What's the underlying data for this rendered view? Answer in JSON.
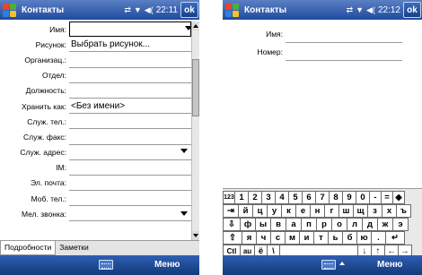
{
  "left_screen": {
    "title": "Контакты",
    "clock": "22:11",
    "ok_label": "ok",
    "fields": [
      {
        "label": "Имя:",
        "value": ""
      },
      {
        "label": "Рисунок:",
        "value": "Выбрать рисунок..."
      },
      {
        "label": "Организац.:",
        "value": ""
      },
      {
        "label": "Отдел:",
        "value": ""
      },
      {
        "label": "Должность:",
        "value": ""
      },
      {
        "label": "Хранить как:",
        "value": "<Без имени>"
      },
      {
        "label": "Служ. тел.:",
        "value": ""
      },
      {
        "label": "Служ. факс:",
        "value": ""
      },
      {
        "label": "Служ. адрес:",
        "value": ""
      },
      {
        "label": "IM:",
        "value": ""
      },
      {
        "label": "Эл. почта:",
        "value": ""
      },
      {
        "label": "Моб. тел.:",
        "value": ""
      },
      {
        "label": "Мел. звонка:",
        "value": ""
      }
    ],
    "tabs": [
      "Подробности",
      "Заметки"
    ],
    "menu_label": "Меню"
  },
  "right_screen": {
    "title": "Контакты",
    "clock": "22:12",
    "ok_label": "ok",
    "fields": [
      {
        "label": "Имя:",
        "value": ""
      },
      {
        "label": "Номер:",
        "value": ""
      }
    ],
    "keyboard": {
      "rows": [
        [
          "123",
          "1",
          "2",
          "3",
          "4",
          "5",
          "6",
          "7",
          "8",
          "9",
          "0",
          "-",
          "=",
          "◆"
        ],
        [
          "⇥",
          "й",
          "ц",
          "у",
          "к",
          "е",
          "н",
          "г",
          "ш",
          "щ",
          "з",
          "х",
          "ъ"
        ],
        [
          "⇩",
          "ф",
          "ы",
          "в",
          "а",
          "п",
          "р",
          "о",
          "л",
          "д",
          "ж",
          "э"
        ],
        [
          "⇧",
          "я",
          "ч",
          "с",
          "м",
          "и",
          "т",
          "ь",
          "б",
          "ю",
          ".",
          "↵"
        ],
        [
          "Ctl",
          "au",
          "ё",
          "\\",
          " ",
          "↓",
          "↑",
          "←",
          "→"
        ]
      ]
    },
    "menu_label": "Меню"
  },
  "colors": {
    "titlebar": "#2a57a8",
    "menubar": "#1f4a9e",
    "windows_logo_red": "#e8452c",
    "windows_logo_green": "#4caf3c",
    "windows_logo_blue": "#2f7fe0",
    "windows_logo_yellow": "#f6c12b"
  }
}
